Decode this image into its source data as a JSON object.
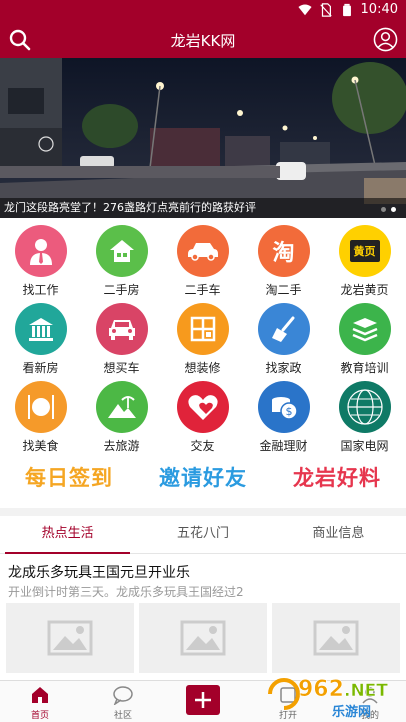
{
  "status": {
    "time": "10:40"
  },
  "header": {
    "title": "龙岩KK网"
  },
  "banner": {
    "caption": "龙门这段路亮堂了！276盏路灯点亮前行的路获好评"
  },
  "grid": [
    {
      "label": "找工作",
      "color": "#ec5b7d",
      "icon": "person-tie-icon"
    },
    {
      "label": "二手房",
      "color": "#5bbf4a",
      "icon": "house-icon"
    },
    {
      "label": "二手车",
      "color": "#f26b3a",
      "icon": "car-icon"
    },
    {
      "label": "淘二手",
      "color": "#f26b3a",
      "icon": "tao-icon",
      "glyph": "淘"
    },
    {
      "label": "龙岩黄页",
      "color": "#ffd000",
      "icon": "yellow-pages-icon",
      "glyph": "黄页"
    },
    {
      "label": "看新房",
      "color": "#21a79a",
      "icon": "building-icon"
    },
    {
      "label": "想买车",
      "color": "#d94466",
      "icon": "car-front-icon"
    },
    {
      "label": "想装修",
      "color": "#f79a1d",
      "icon": "window-icon"
    },
    {
      "label": "找家政",
      "color": "#3a86d6",
      "icon": "broom-icon"
    },
    {
      "label": "教育培训",
      "color": "#3cb44b",
      "icon": "books-icon"
    },
    {
      "label": "找美食",
      "color": "#f59a2a",
      "icon": "cutlery-icon"
    },
    {
      "label": "去旅游",
      "color": "#4cb845",
      "icon": "palm-tree-icon"
    },
    {
      "label": "交友",
      "color": "#e0233a",
      "icon": "heart-icon"
    },
    {
      "label": "金融理财",
      "color": "#2a74c9",
      "icon": "coin-icon"
    },
    {
      "label": "国家电网",
      "color": "#0f7a66",
      "icon": "state-grid-logo"
    }
  ],
  "promos": [
    {
      "text": "每日签到",
      "color": "#f5a623"
    },
    {
      "text": "邀请好友",
      "color": "#2b9be0"
    },
    {
      "text": "龙岩好料",
      "color": "#e6364e"
    }
  ],
  "tabs": [
    "热点生活",
    "五花八门",
    "商业信息"
  ],
  "article": {
    "title": "龙成乐多玩具王国元旦开业乐",
    "subtitle": "开业倒计时第三天。龙成乐多玩具王国经过2"
  },
  "bottomnav": [
    {
      "label": "首页"
    },
    {
      "label": "社区"
    },
    {
      "label": ""
    },
    {
      "label": "打开"
    },
    {
      "label": "我的"
    }
  ],
  "watermark": {
    "brand": "962.NET",
    "sub": "乐游网"
  },
  "colors": {
    "primary": "#a3002a"
  }
}
